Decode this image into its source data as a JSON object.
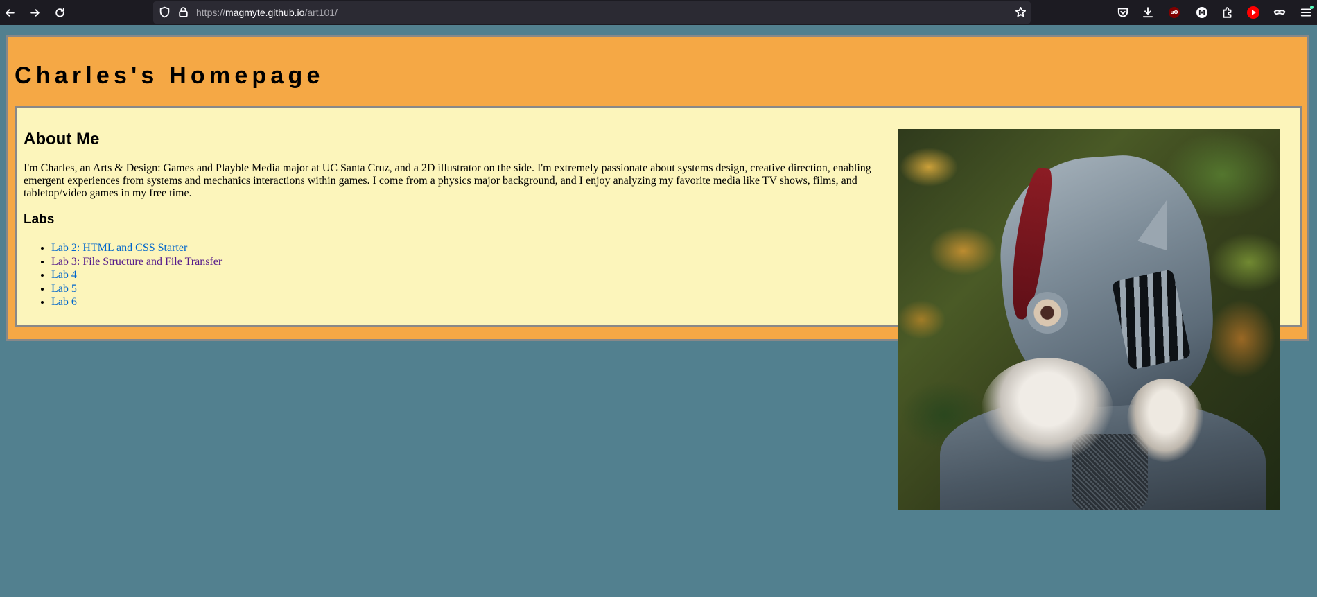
{
  "browser": {
    "url_scheme": "https://",
    "url_host": "magmyte.github.io",
    "url_path": "/art101/"
  },
  "page": {
    "site_title": "Charles's Homepage",
    "about_heading": "About Me",
    "about_text": "I'm Charles, an Arts & Design: Games and Playble Media major at UC Santa Cruz, and a 2D illustrator on the side. I'm extremely passionate about systems design, creative direction, enabling emergent experiences from systems and mechanics interactions within games. I come from a physics major background, and I enjoy analyzing my favorite media like TV shows, films, and tabletop/video games in my free time.",
    "labs_heading": "Labs",
    "labs": [
      {
        "label": "Lab 2: HTML and CSS Starter",
        "visited": false
      },
      {
        "label": "Lab 3: File Structure and File Transfer",
        "visited": true
      },
      {
        "label": "Lab 4",
        "visited": false
      },
      {
        "label": "Lab 5",
        "visited": false
      },
      {
        "label": "Lab 6",
        "visited": false
      }
    ]
  },
  "colors": {
    "page_background": "#52808f",
    "header_background": "#f5a845",
    "content_background": "#fcf5bb",
    "border": "#888888",
    "link": "#0066cc",
    "link_visited": "#551a8b"
  },
  "icons": {
    "toolbar_left": [
      "back-arrow-icon",
      "forward-arrow-icon",
      "reload-icon"
    ],
    "urlbar": [
      "tracking-shield-icon",
      "lock-icon",
      "bookmark-star-icon"
    ],
    "toolbar_right": [
      "pocket-icon",
      "downloads-icon",
      "ublock-origin-icon",
      "m-extension-icon",
      "extensions-puzzle-icon",
      "youtube-icon",
      "account-mask-icon",
      "app-menu-icon"
    ]
  }
}
